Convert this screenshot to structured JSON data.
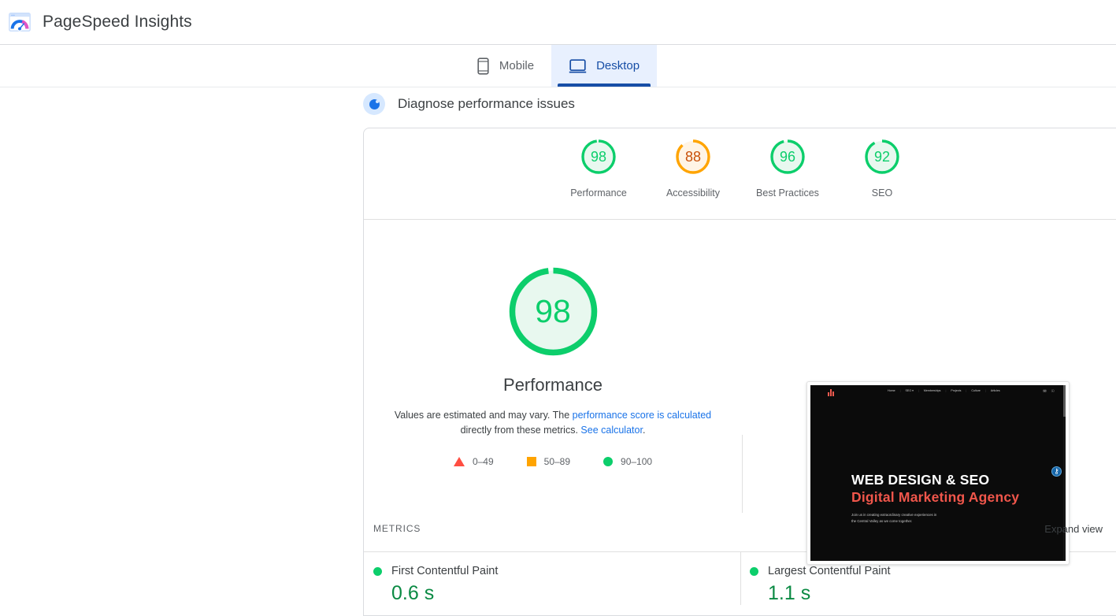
{
  "header": {
    "title": "PageSpeed Insights",
    "logo_icon": "pagespeed-logo-icon"
  },
  "tabs": [
    {
      "label": "Mobile",
      "icon": "mobile-icon",
      "active": false
    },
    {
      "label": "Desktop",
      "icon": "desktop-icon",
      "active": true
    }
  ],
  "diagnose": {
    "label": "Diagnose performance issues",
    "icon": "diagnose-icon"
  },
  "category_scores": [
    {
      "label": "Performance",
      "value": "98",
      "color": "#0cce6b",
      "fill": "#e8f8ef",
      "text_color": "#0cce6b"
    },
    {
      "label": "Accessibility",
      "value": "88",
      "color": "#ffa400",
      "fill": "#fff4e5",
      "text_color": "#c8500a"
    },
    {
      "label": "Best Practices",
      "value": "96",
      "color": "#0cce6b",
      "fill": "#e8f8ef",
      "text_color": "#0cce6b"
    },
    {
      "label": "SEO",
      "value": "92",
      "color": "#0cce6b",
      "fill": "#e8f8ef",
      "text_color": "#0cce6b"
    }
  ],
  "hero": {
    "score": "98",
    "score_color": "#0cce6b",
    "score_fill": "#e8f8ef",
    "label": "Performance",
    "note_part1": "Values are estimated and may vary. The ",
    "note_link1": "performance score is calculated",
    "note_part2": " directly from these metrics. ",
    "note_link2": "See calculator",
    "note_part3": "."
  },
  "legend": [
    {
      "shape": "triangle",
      "range": "0–49",
      "color": "#ff4e42"
    },
    {
      "shape": "square",
      "range": "50–89",
      "color": "#ffa400"
    },
    {
      "shape": "circle",
      "range": "90–100",
      "color": "#0cce6b"
    }
  ],
  "thumbnail": {
    "nav_items": [
      "Home",
      "SEO ▾",
      "Memberships",
      "Projects",
      "Culture",
      "Articles"
    ],
    "nav_icons": [
      "mail-icon",
      "globe-icon"
    ],
    "logo_icon": "site-logo-icon",
    "headline": "WEB DESIGN & SEO",
    "subheadline": "Digital Marketing Agency",
    "paragraph_line1": "Join us in creating extraordinary creative experiences in",
    "paragraph_line2": "the Central Valley as we come together.",
    "a11y_icon": "accessibility-icon",
    "bg_color": "#0b0b0b",
    "accent_color": "#f0564b"
  },
  "metrics_section": {
    "title": "METRICS",
    "expand_label": "Expand view",
    "metrics": [
      {
        "name": "First Contentful Paint",
        "value": "0.6 s",
        "status_color": "#0cce6b"
      },
      {
        "name": "Largest Contentful Paint",
        "value": "1.1 s",
        "status_color": "#0cce6b"
      }
    ]
  }
}
